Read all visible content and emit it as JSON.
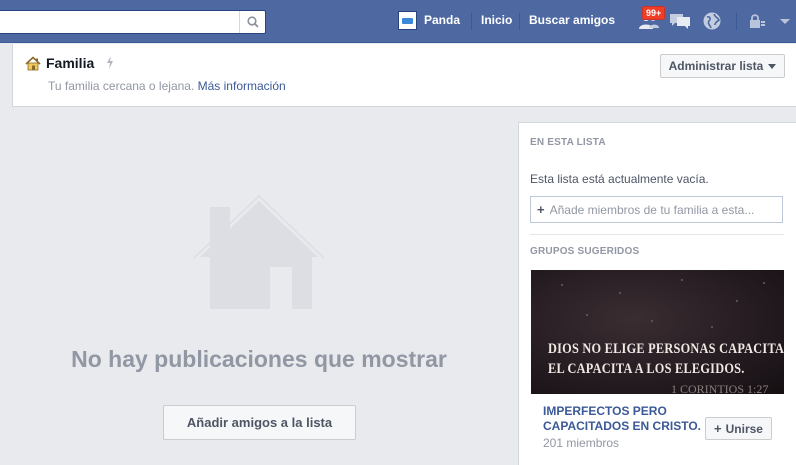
{
  "topbar": {
    "search_placeholder": "",
    "user_name": "Panda",
    "home_label": "Inicio",
    "find_friends_label": "Buscar amigos",
    "notification_badge": "99+"
  },
  "header": {
    "title": "Familia",
    "subtitle": "Tu familia cercana o lejana.",
    "more_info_link": "Más información",
    "admin_button": "Administrar lista"
  },
  "main": {
    "empty_message": "No hay publicaciones que mostrar",
    "add_friends_button": "Añadir amigos a la lista"
  },
  "sidebar": {
    "in_list_heading": "EN ESTA LISTA",
    "empty_list_text": "Esta lista está actualmente vacía.",
    "add_members_placeholder": "Añade miembros de tu familia a esta...",
    "suggested_groups_heading": "GRUPOS SUGERIDOS",
    "group": {
      "image_line1": "DIOS NO ELIGE PERSONAS CAPACITADAS,",
      "image_line2": "EL CAPACITA A LOS ELEGIDOS.",
      "image_line3": "1 CORINTIOS 1:27",
      "name": "IMPERFECTOS PERO CAPACITADOS EN CRISTO.",
      "members": "201 miembros",
      "join_button": "Unirse"
    }
  },
  "colors": {
    "topbar": "#4e69a2",
    "link": "#3b5998",
    "badge": "#f03d25",
    "background": "#e9eaed"
  }
}
